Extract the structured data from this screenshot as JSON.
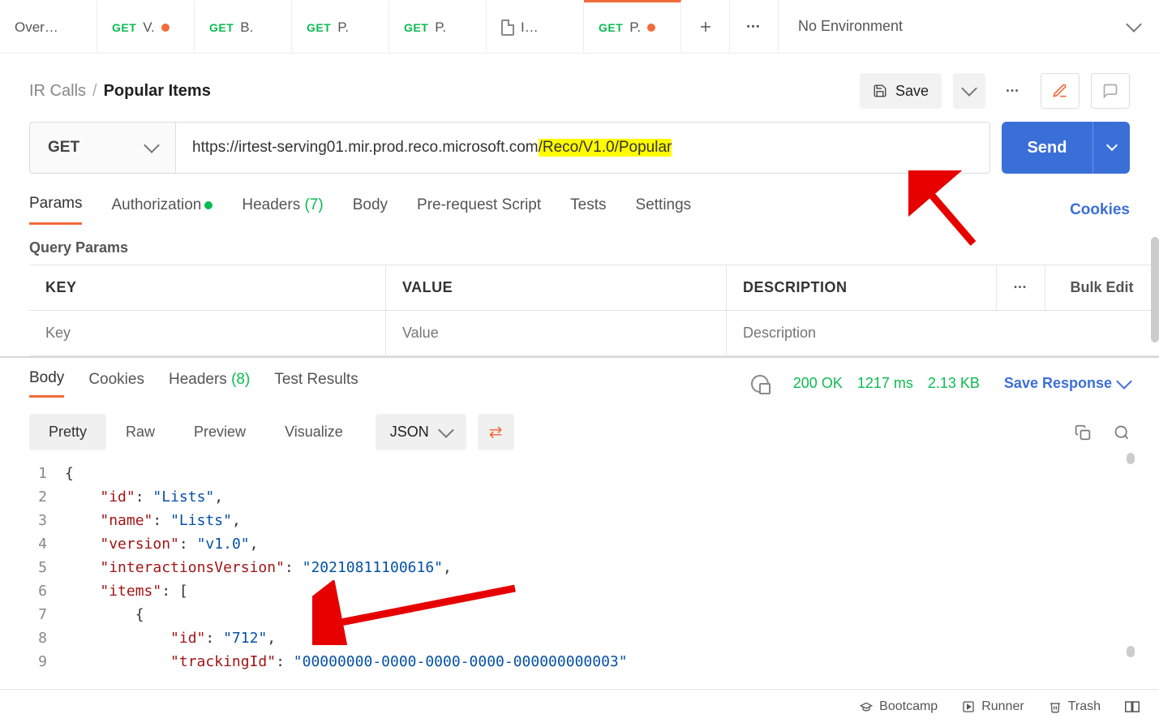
{
  "tabs": [
    {
      "label": "Over…",
      "method": "",
      "dirty": false,
      "icon": ""
    },
    {
      "label": "V.",
      "method": "GET",
      "dirty": true
    },
    {
      "label": "B.",
      "method": "GET",
      "dirty": false
    },
    {
      "label": "P.",
      "method": "GET",
      "dirty": false
    },
    {
      "label": "P.",
      "method": "GET",
      "dirty": false
    },
    {
      "label": "I…",
      "method": "",
      "icon": "file"
    },
    {
      "label": "P.",
      "method": "GET",
      "dirty": true,
      "active": true
    }
  ],
  "env": {
    "label": "No Environment"
  },
  "crumbs": {
    "collection": "IR Calls",
    "request": "Popular Items"
  },
  "save": {
    "label": "Save"
  },
  "url": {
    "method": "GET",
    "base": "https://irtest-serving01.mir.prod.reco.microsoft.com",
    "hl": "/Reco/V1.0/Popular"
  },
  "send": {
    "label": "Send"
  },
  "reqtabs": {
    "params": "Params",
    "auth": "Authorization",
    "headers": "Headers",
    "headers_count": "(7)",
    "body": "Body",
    "prereq": "Pre-request Script",
    "tests": "Tests",
    "settings": "Settings",
    "cookies": "Cookies"
  },
  "query": {
    "title": "Query Params",
    "key": "KEY",
    "value": "VALUE",
    "desc": "DESCRIPTION",
    "bulk": "Bulk Edit",
    "key_ph": "Key",
    "value_ph": "Value",
    "desc_ph": "Description"
  },
  "resp": {
    "tabs": {
      "body": "Body",
      "cookies": "Cookies",
      "headers": "Headers",
      "headers_count": "(8)",
      "tests": "Test Results"
    },
    "status": {
      "code": "200 OK",
      "time": "1217 ms",
      "size": "2.13 KB"
    },
    "save": "Save Response",
    "views": {
      "pretty": "Pretty",
      "raw": "Raw",
      "preview": "Preview",
      "visualize": "Visualize"
    },
    "format": "JSON"
  },
  "json_lines": [
    {
      "n": "1",
      "indent": "",
      "tokens": [
        {
          "c": "b",
          "t": "{"
        }
      ]
    },
    {
      "n": "2",
      "indent": "    ",
      "tokens": [
        {
          "c": "k",
          "t": "\"id\""
        },
        {
          "c": "p",
          "t": ": "
        },
        {
          "c": "s",
          "t": "\"Lists\""
        },
        {
          "c": "p",
          "t": ","
        }
      ]
    },
    {
      "n": "3",
      "indent": "    ",
      "tokens": [
        {
          "c": "k",
          "t": "\"name\""
        },
        {
          "c": "p",
          "t": ": "
        },
        {
          "c": "s",
          "t": "\"Lists\""
        },
        {
          "c": "p",
          "t": ","
        }
      ]
    },
    {
      "n": "4",
      "indent": "    ",
      "tokens": [
        {
          "c": "k",
          "t": "\"version\""
        },
        {
          "c": "p",
          "t": ": "
        },
        {
          "c": "s",
          "t": "\"v1.0\""
        },
        {
          "c": "p",
          "t": ","
        }
      ]
    },
    {
      "n": "5",
      "indent": "    ",
      "tokens": [
        {
          "c": "k",
          "t": "\"interactionsVersion\""
        },
        {
          "c": "p",
          "t": ": "
        },
        {
          "c": "s",
          "t": "\"20210811100616\""
        },
        {
          "c": "p",
          "t": ","
        }
      ]
    },
    {
      "n": "6",
      "indent": "    ",
      "tokens": [
        {
          "c": "k",
          "t": "\"items\""
        },
        {
          "c": "p",
          "t": ": ["
        }
      ]
    },
    {
      "n": "7",
      "indent": "        ",
      "tokens": [
        {
          "c": "b",
          "t": "{"
        }
      ]
    },
    {
      "n": "8",
      "indent": "            ",
      "tokens": [
        {
          "c": "k",
          "t": "\"id\""
        },
        {
          "c": "p",
          "t": ": "
        },
        {
          "c": "s",
          "t": "\"712\""
        },
        {
          "c": "p",
          "t": ","
        }
      ]
    },
    {
      "n": "9",
      "indent": "            ",
      "tokens": [
        {
          "c": "k",
          "t": "\"trackingId\""
        },
        {
          "c": "p",
          "t": ": "
        },
        {
          "c": "s",
          "t": "\"00000000-0000-0000-0000-000000000003\""
        }
      ]
    }
  ],
  "footer": {
    "boot": "Bootcamp",
    "runner": "Runner",
    "trash": "Trash"
  }
}
